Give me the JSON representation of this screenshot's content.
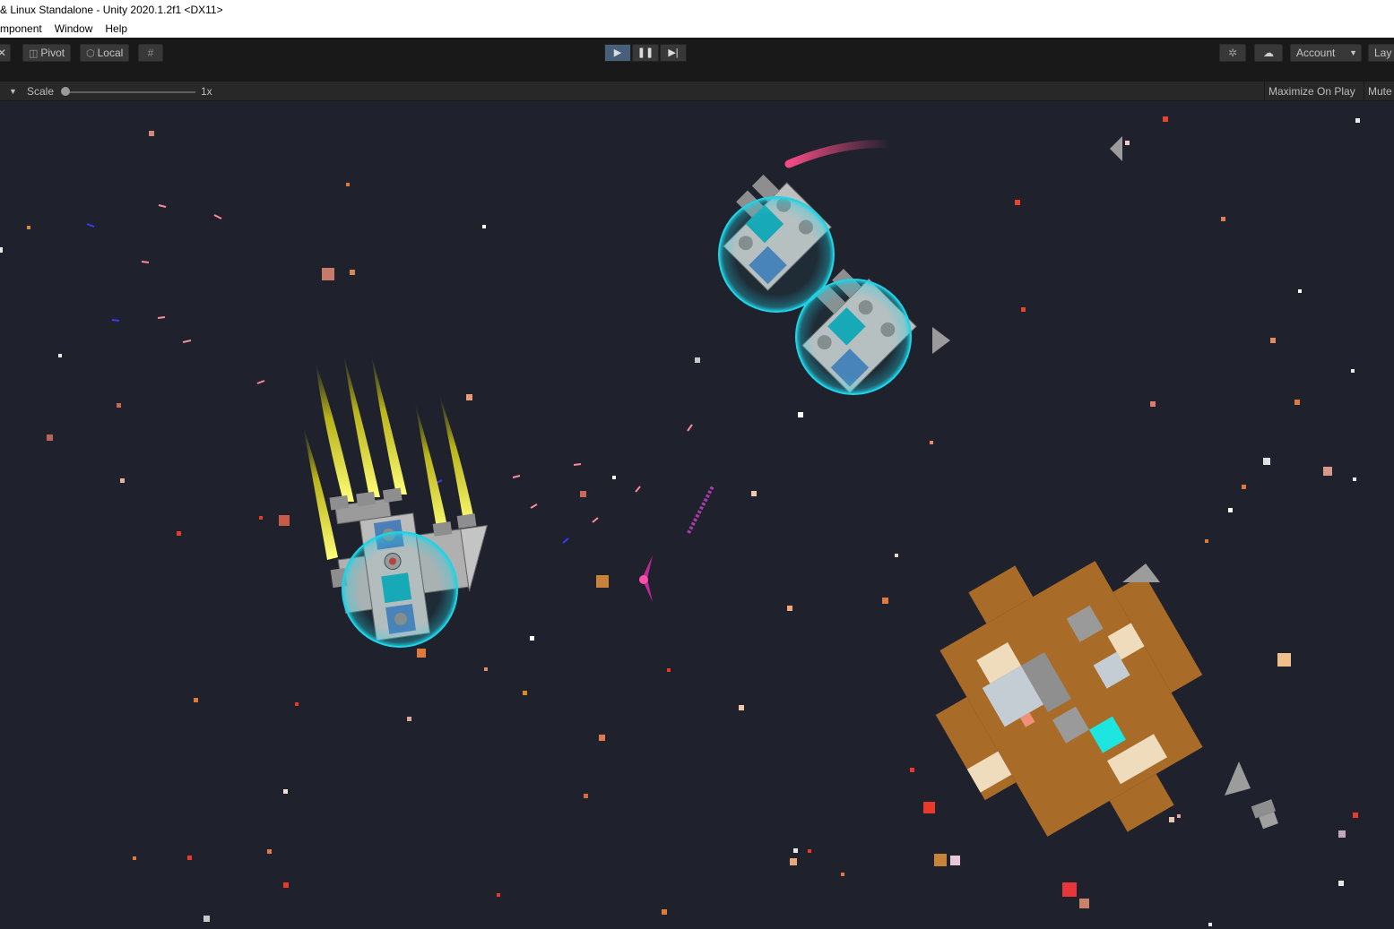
{
  "window": {
    "title": "& Linux Standalone - Unity 2020.1.2f1 <DX11>"
  },
  "menu": {
    "items": [
      "mponent",
      "Window",
      "Help"
    ]
  },
  "toolbar": {
    "pivot_label": "Pivot",
    "local_label": "Local",
    "account_label": "Account",
    "layers_label": "Lay",
    "pivot_icon": "pivot-icon",
    "local_icon": "local-cube-icon",
    "grid_icon": "grid-snap-icon",
    "collab_icon": "collab-icon",
    "cloud_icon": "cloud-icon",
    "play_state": "playing"
  },
  "game_view": {
    "scale_label": "Scale",
    "scale_value": "1x",
    "scale_fraction": 0.0,
    "maximize_label": "Maximize On Play",
    "mute_label": "Mute"
  },
  "colors": {
    "background": "#1f222c",
    "shield": "#1fd3e6",
    "thrust": "#f4f01c",
    "asteroid": "#a86b28",
    "accent_play": "#46607c"
  }
}
